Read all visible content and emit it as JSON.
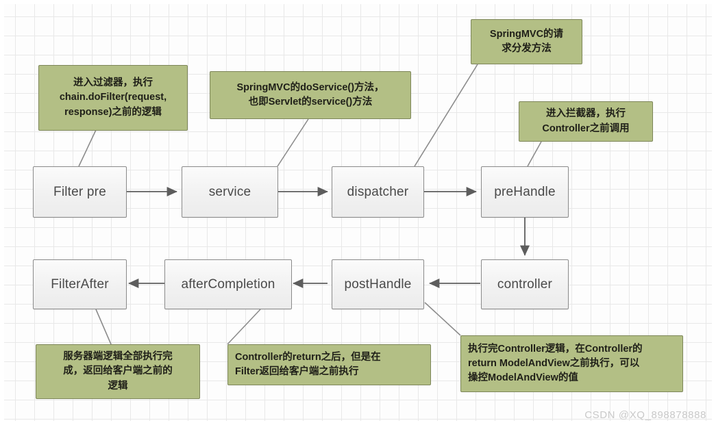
{
  "diagram": {
    "title": "SpringMVC request lifecycle flow",
    "colors": {
      "note_fill": "#b3bf85",
      "note_border": "#7d8659",
      "node_fill": "#f1f1f1",
      "node_border": "#8a8a8a",
      "line": "#6f6f6f",
      "grid": "#e8e8e8",
      "watermark": "#c9c9c9"
    },
    "nodes": [
      {
        "id": "filter-pre",
        "label": "Filter pre"
      },
      {
        "id": "service",
        "label": "service"
      },
      {
        "id": "dispatcher",
        "label": "dispatcher"
      },
      {
        "id": "prehandle",
        "label": "preHandle"
      },
      {
        "id": "controller",
        "label": "controller"
      },
      {
        "id": "posthandle",
        "label": "postHandle"
      },
      {
        "id": "aftercompletion",
        "label": "afterCompletion"
      },
      {
        "id": "filterafter",
        "label": "FilterAfter"
      }
    ],
    "notes": [
      {
        "id": "note-filter-pre",
        "lines": [
          "进入过滤器，执行",
          "chain.doFilter(request,",
          "response)之前的逻辑"
        ]
      },
      {
        "id": "note-service",
        "lines": [
          "SpringMVC的doService()方法，",
          "也即Servlet的service()方法"
        ]
      },
      {
        "id": "note-dispatcher",
        "lines": [
          "SpringMVC的请",
          "求分发方法"
        ]
      },
      {
        "id": "note-prehandle",
        "lines": [
          "进入拦截器，执行",
          "Controller之前调用"
        ]
      },
      {
        "id": "note-filterafter",
        "lines": [
          "服务器端逻辑全部执行完",
          "成，返回给客户端之前的",
          "逻辑"
        ]
      },
      {
        "id": "note-aftercompletion",
        "lines": [
          "Controller的return之后，但是在",
          "Filter返回给客户端之前执行"
        ]
      },
      {
        "id": "note-posthandle",
        "lines": [
          "执行完Controller逻辑，在Controller的",
          "return ModelAndView之前执行，可以",
          "操控ModelAndView的值"
        ]
      }
    ],
    "edges": [
      {
        "from": "filter-pre",
        "to": "service",
        "direction": "right"
      },
      {
        "from": "service",
        "to": "dispatcher",
        "direction": "right"
      },
      {
        "from": "dispatcher",
        "to": "prehandle",
        "direction": "right"
      },
      {
        "from": "prehandle",
        "to": "controller",
        "direction": "down"
      },
      {
        "from": "controller",
        "to": "posthandle",
        "direction": "left"
      },
      {
        "from": "posthandle",
        "to": "aftercompletion",
        "direction": "left"
      },
      {
        "from": "aftercompletion",
        "to": "filterafter",
        "direction": "left"
      }
    ]
  },
  "watermark": {
    "text": "CSDN @XQ_898878888"
  }
}
